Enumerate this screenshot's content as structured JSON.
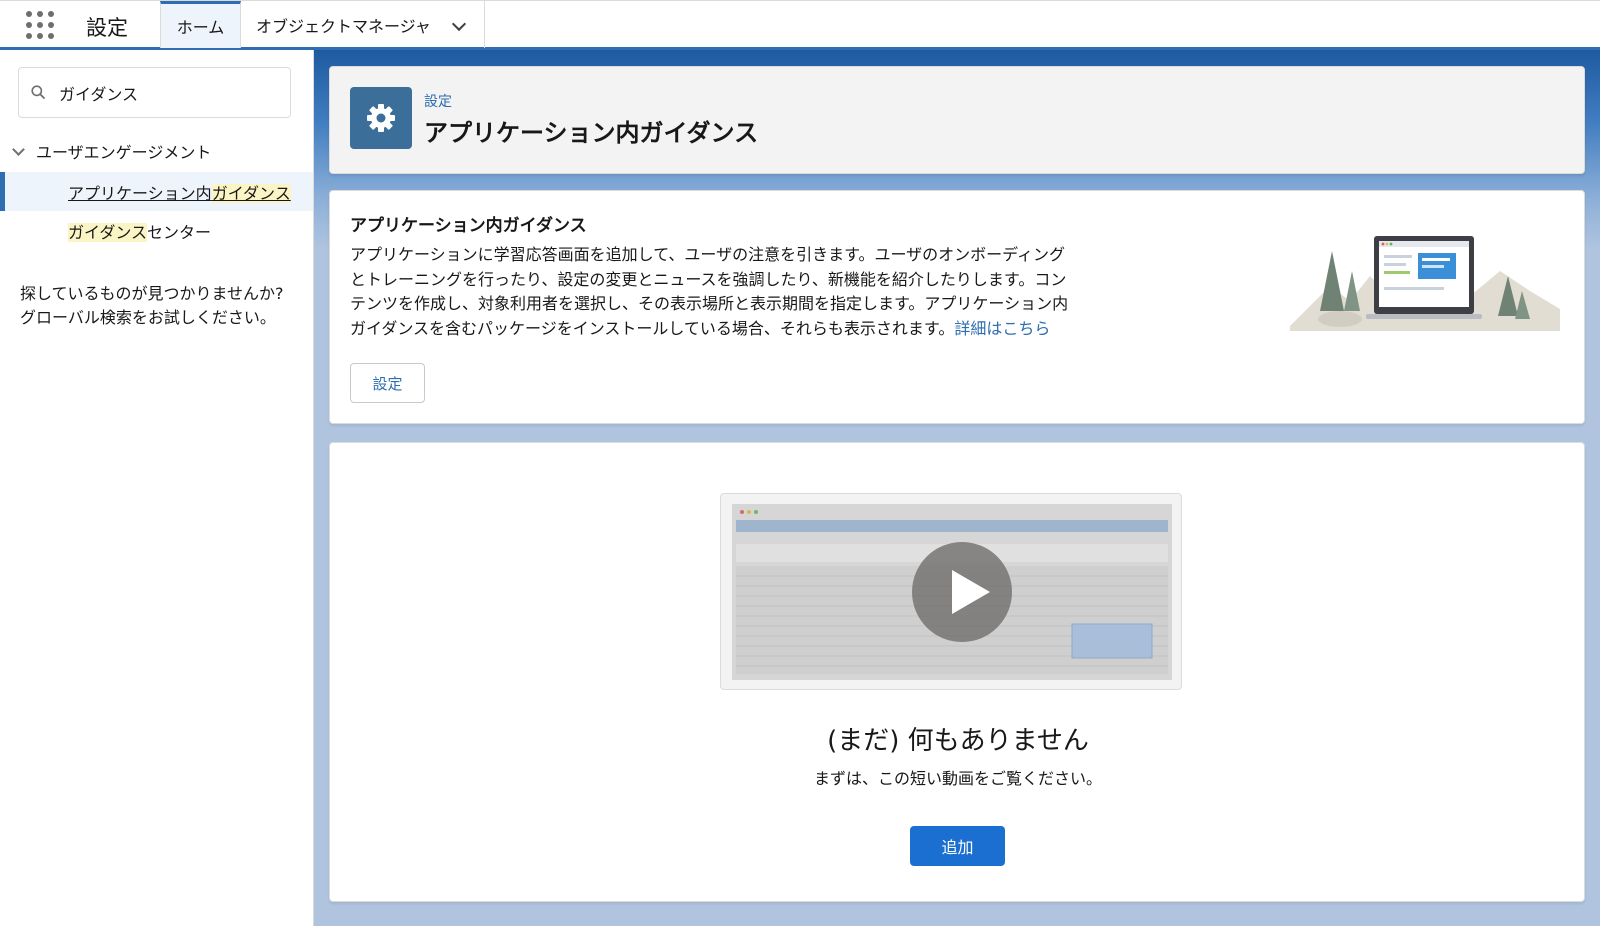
{
  "topnav": {
    "app_name": "設定",
    "tabs": [
      {
        "label": "ホーム"
      },
      {
        "label": "オブジェクトマネージャ"
      }
    ]
  },
  "sidebar": {
    "search": {
      "value": "ガイダンス",
      "placeholder": ""
    },
    "tree": {
      "parent_label": "ユーザエンゲージメント",
      "items": [
        {
          "label_prefix": "アプリケーション内",
          "label_highlight": "ガイダンス",
          "label_suffix": ""
        },
        {
          "label_prefix": "",
          "label_highlight": "ガイダンス",
          "label_suffix": "センター"
        }
      ]
    },
    "not_found_line1": "探しているものが見つかりませんか?",
    "not_found_line2": "グローバル検索をお試しください。"
  },
  "header": {
    "breadcrumb": "設定",
    "title": "アプリケーション内ガイダンス",
    "icon": "gear-icon"
  },
  "info": {
    "title": "アプリケーション内ガイダンス",
    "body_lines": [
      "アプリケーションに学習応答画面を追加して、ユーザの注意を引きます。ユーザのオンボーディング",
      "とトレーニングを行ったり、設定の変更とニュースを強調したり、新機能を紹介したりします。コン",
      "テンツを作成し、対象利用者を選択し、その表示場所と表示期間を指定します。アプリケーション内",
      "ガイダンスを含むパッケージをインストールしている場合、それらも表示されます。"
    ],
    "link": "詳細はこちら",
    "settings_button": "設定"
  },
  "empty_state": {
    "title": "(まだ) 何もありません",
    "subtitle": "まずは、この短い動画をご覧ください。",
    "add_button": "追加"
  },
  "colors": {
    "brand": "#2e6db0",
    "button_primary": "#1b6fd1",
    "highlight": "#fbf5c5",
    "header_icon_bg": "#3b6e98"
  }
}
